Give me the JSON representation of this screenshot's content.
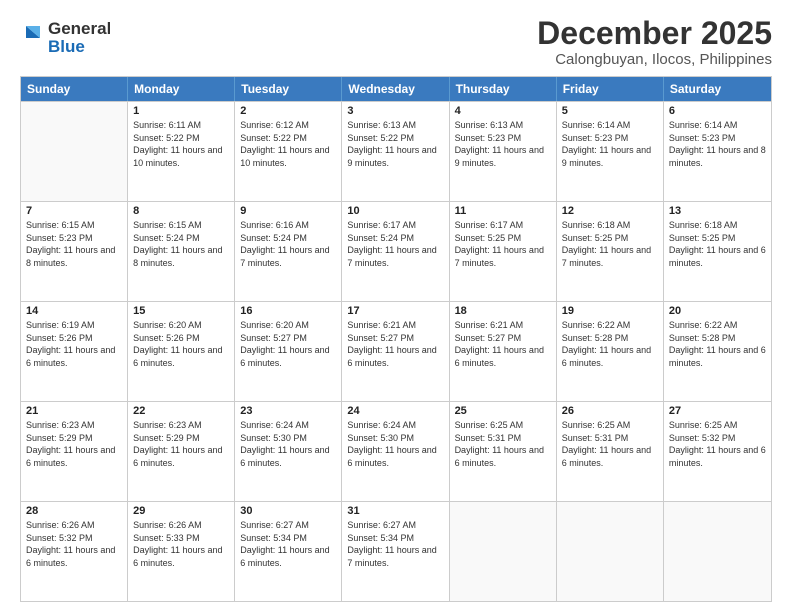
{
  "logo": {
    "text_general": "General",
    "text_blue": "Blue"
  },
  "title": {
    "month": "December 2025",
    "location": "Calongbuyan, Ilocos, Philippines"
  },
  "header_days": [
    "Sunday",
    "Monday",
    "Tuesday",
    "Wednesday",
    "Thursday",
    "Friday",
    "Saturday"
  ],
  "weeks": [
    [
      {
        "day": "",
        "sunrise": "",
        "sunset": "",
        "daylight": ""
      },
      {
        "day": "1",
        "sunrise": "Sunrise: 6:11 AM",
        "sunset": "Sunset: 5:22 PM",
        "daylight": "Daylight: 11 hours and 10 minutes."
      },
      {
        "day": "2",
        "sunrise": "Sunrise: 6:12 AM",
        "sunset": "Sunset: 5:22 PM",
        "daylight": "Daylight: 11 hours and 10 minutes."
      },
      {
        "day": "3",
        "sunrise": "Sunrise: 6:13 AM",
        "sunset": "Sunset: 5:22 PM",
        "daylight": "Daylight: 11 hours and 9 minutes."
      },
      {
        "day": "4",
        "sunrise": "Sunrise: 6:13 AM",
        "sunset": "Sunset: 5:23 PM",
        "daylight": "Daylight: 11 hours and 9 minutes."
      },
      {
        "day": "5",
        "sunrise": "Sunrise: 6:14 AM",
        "sunset": "Sunset: 5:23 PM",
        "daylight": "Daylight: 11 hours and 9 minutes."
      },
      {
        "day": "6",
        "sunrise": "Sunrise: 6:14 AM",
        "sunset": "Sunset: 5:23 PM",
        "daylight": "Daylight: 11 hours and 8 minutes."
      }
    ],
    [
      {
        "day": "7",
        "sunrise": "Sunrise: 6:15 AM",
        "sunset": "Sunset: 5:23 PM",
        "daylight": "Daylight: 11 hours and 8 minutes."
      },
      {
        "day": "8",
        "sunrise": "Sunrise: 6:15 AM",
        "sunset": "Sunset: 5:24 PM",
        "daylight": "Daylight: 11 hours and 8 minutes."
      },
      {
        "day": "9",
        "sunrise": "Sunrise: 6:16 AM",
        "sunset": "Sunset: 5:24 PM",
        "daylight": "Daylight: 11 hours and 7 minutes."
      },
      {
        "day": "10",
        "sunrise": "Sunrise: 6:17 AM",
        "sunset": "Sunset: 5:24 PM",
        "daylight": "Daylight: 11 hours and 7 minutes."
      },
      {
        "day": "11",
        "sunrise": "Sunrise: 6:17 AM",
        "sunset": "Sunset: 5:25 PM",
        "daylight": "Daylight: 11 hours and 7 minutes."
      },
      {
        "day": "12",
        "sunrise": "Sunrise: 6:18 AM",
        "sunset": "Sunset: 5:25 PM",
        "daylight": "Daylight: 11 hours and 7 minutes."
      },
      {
        "day": "13",
        "sunrise": "Sunrise: 6:18 AM",
        "sunset": "Sunset: 5:25 PM",
        "daylight": "Daylight: 11 hours and 6 minutes."
      }
    ],
    [
      {
        "day": "14",
        "sunrise": "Sunrise: 6:19 AM",
        "sunset": "Sunset: 5:26 PM",
        "daylight": "Daylight: 11 hours and 6 minutes."
      },
      {
        "day": "15",
        "sunrise": "Sunrise: 6:20 AM",
        "sunset": "Sunset: 5:26 PM",
        "daylight": "Daylight: 11 hours and 6 minutes."
      },
      {
        "day": "16",
        "sunrise": "Sunrise: 6:20 AM",
        "sunset": "Sunset: 5:27 PM",
        "daylight": "Daylight: 11 hours and 6 minutes."
      },
      {
        "day": "17",
        "sunrise": "Sunrise: 6:21 AM",
        "sunset": "Sunset: 5:27 PM",
        "daylight": "Daylight: 11 hours and 6 minutes."
      },
      {
        "day": "18",
        "sunrise": "Sunrise: 6:21 AM",
        "sunset": "Sunset: 5:27 PM",
        "daylight": "Daylight: 11 hours and 6 minutes."
      },
      {
        "day": "19",
        "sunrise": "Sunrise: 6:22 AM",
        "sunset": "Sunset: 5:28 PM",
        "daylight": "Daylight: 11 hours and 6 minutes."
      },
      {
        "day": "20",
        "sunrise": "Sunrise: 6:22 AM",
        "sunset": "Sunset: 5:28 PM",
        "daylight": "Daylight: 11 hours and 6 minutes."
      }
    ],
    [
      {
        "day": "21",
        "sunrise": "Sunrise: 6:23 AM",
        "sunset": "Sunset: 5:29 PM",
        "daylight": "Daylight: 11 hours and 6 minutes."
      },
      {
        "day": "22",
        "sunrise": "Sunrise: 6:23 AM",
        "sunset": "Sunset: 5:29 PM",
        "daylight": "Daylight: 11 hours and 6 minutes."
      },
      {
        "day": "23",
        "sunrise": "Sunrise: 6:24 AM",
        "sunset": "Sunset: 5:30 PM",
        "daylight": "Daylight: 11 hours and 6 minutes."
      },
      {
        "day": "24",
        "sunrise": "Sunrise: 6:24 AM",
        "sunset": "Sunset: 5:30 PM",
        "daylight": "Daylight: 11 hours and 6 minutes."
      },
      {
        "day": "25",
        "sunrise": "Sunrise: 6:25 AM",
        "sunset": "Sunset: 5:31 PM",
        "daylight": "Daylight: 11 hours and 6 minutes."
      },
      {
        "day": "26",
        "sunrise": "Sunrise: 6:25 AM",
        "sunset": "Sunset: 5:31 PM",
        "daylight": "Daylight: 11 hours and 6 minutes."
      },
      {
        "day": "27",
        "sunrise": "Sunrise: 6:25 AM",
        "sunset": "Sunset: 5:32 PM",
        "daylight": "Daylight: 11 hours and 6 minutes."
      }
    ],
    [
      {
        "day": "28",
        "sunrise": "Sunrise: 6:26 AM",
        "sunset": "Sunset: 5:32 PM",
        "daylight": "Daylight: 11 hours and 6 minutes."
      },
      {
        "day": "29",
        "sunrise": "Sunrise: 6:26 AM",
        "sunset": "Sunset: 5:33 PM",
        "daylight": "Daylight: 11 hours and 6 minutes."
      },
      {
        "day": "30",
        "sunrise": "Sunrise: 6:27 AM",
        "sunset": "Sunset: 5:34 PM",
        "daylight": "Daylight: 11 hours and 6 minutes."
      },
      {
        "day": "31",
        "sunrise": "Sunrise: 6:27 AM",
        "sunset": "Sunset: 5:34 PM",
        "daylight": "Daylight: 11 hours and 7 minutes."
      },
      {
        "day": "",
        "sunrise": "",
        "sunset": "",
        "daylight": ""
      },
      {
        "day": "",
        "sunrise": "",
        "sunset": "",
        "daylight": ""
      },
      {
        "day": "",
        "sunrise": "",
        "sunset": "",
        "daylight": ""
      }
    ]
  ]
}
